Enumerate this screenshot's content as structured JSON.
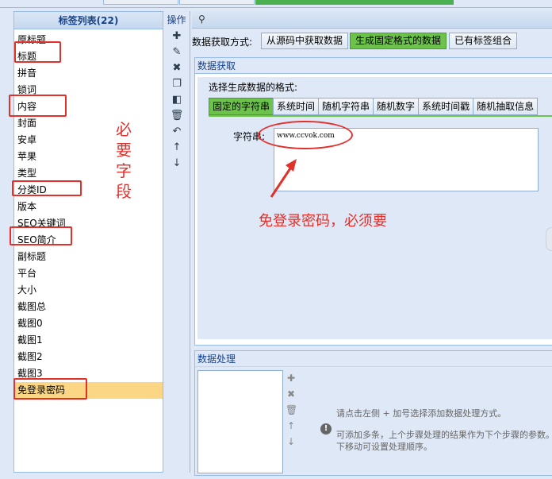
{
  "left_panel": {
    "header": "标签列表(22)",
    "tags": [
      {
        "label": "原标题",
        "selected": false
      },
      {
        "label": "标题",
        "selected": false
      },
      {
        "label": "拼音",
        "selected": false
      },
      {
        "label": "锁词",
        "selected": false
      },
      {
        "label": "内容",
        "selected": false
      },
      {
        "label": "封面",
        "selected": false
      },
      {
        "label": "安卓",
        "selected": false
      },
      {
        "label": "苹果",
        "selected": false
      },
      {
        "label": "类型",
        "selected": false
      },
      {
        "label": "分类ID",
        "selected": false
      },
      {
        "label": "版本",
        "selected": false
      },
      {
        "label": "SEO关键词",
        "selected": false
      },
      {
        "label": "SEO简介",
        "selected": false
      },
      {
        "label": "副标题",
        "selected": false
      },
      {
        "label": "平台",
        "selected": false
      },
      {
        "label": "大小",
        "selected": false
      },
      {
        "label": "截图总",
        "selected": false
      },
      {
        "label": "截图0",
        "selected": false
      },
      {
        "label": "截图1",
        "selected": false
      },
      {
        "label": "截图2",
        "selected": false
      },
      {
        "label": "截图3",
        "selected": false
      },
      {
        "label": "免登录密码",
        "selected": true
      }
    ]
  },
  "toolbar": {
    "title": "操作",
    "icons": [
      "add-icon",
      "edit-icon",
      "delete-icon",
      "copy-icon",
      "paste-icon",
      "trash-icon",
      "undo-icon",
      "move-up-icon",
      "move-down-icon"
    ]
  },
  "fetch_mode": {
    "label": "数据获取方式:",
    "options": [
      "从源码中获取数据",
      "生成固定格式的数据",
      "已有标签组合"
    ],
    "active": "生成固定格式的数据"
  },
  "fetch_panel": {
    "title": "数据获取",
    "choose_label": "选择生成数据的格式:",
    "format_tabs": [
      "固定的字符串",
      "系统时间",
      "随机字符串",
      "随机数字",
      "系统时间戳",
      "随机抽取信息"
    ],
    "active_format": "固定的字符串",
    "string_label": "字符串:",
    "string_value": "www.ccvok.com"
  },
  "process_panel": {
    "title": "数据处理",
    "hint_primary": "请点击左侧 + 加号选择添加数据处理方式。",
    "hint_secondary": "可添加多条，上个步骤处理的结果作为下个步骤的参数。上下移动可设置处理顺序。"
  },
  "annotations": {
    "required_fields": "必要字段",
    "password_note": "免登录密码，必须要"
  },
  "colors": {
    "accent_green": "#6cc24a",
    "annotation_red": "#e2302b",
    "selected_row": "#fbd684",
    "panel_bg": "#dfe8f6",
    "header_text": "#15428b"
  }
}
